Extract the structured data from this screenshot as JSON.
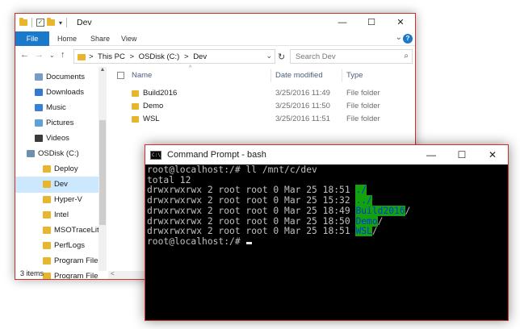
{
  "explorer": {
    "title": "Dev",
    "window_buttons": {
      "minimize": "—",
      "maximize": "☐",
      "close": "✕"
    },
    "ribbon": {
      "file": "File",
      "tabs": [
        "Home",
        "Share",
        "View"
      ]
    },
    "address": {
      "segments": [
        "This PC",
        ">",
        "OSDisk (C:)",
        ">",
        "Dev"
      ],
      "lead_chevron": ">"
    },
    "search_placeholder": "Search Dev",
    "nav_items": [
      {
        "label": "Documents",
        "icon": "documents-icon",
        "color": "#7a9bc5",
        "indent": 1
      },
      {
        "label": "Downloads",
        "icon": "downloads-icon",
        "color": "#2f7bd1",
        "indent": 1
      },
      {
        "label": "Music",
        "icon": "music-icon",
        "color": "#3b7fd0",
        "indent": 1
      },
      {
        "label": "Pictures",
        "icon": "pictures-icon",
        "color": "#5fa0d8",
        "indent": 1
      },
      {
        "label": "Videos",
        "icon": "videos-icon",
        "color": "#3a3a3a",
        "indent": 1
      },
      {
        "label": "OSDisk (C:)",
        "icon": "drive-icon",
        "color": "#6f8fae",
        "indent": 0
      },
      {
        "label": "Deploy",
        "icon": "folder-icon",
        "color": "#e8b52f",
        "indent": 2
      },
      {
        "label": "Dev",
        "icon": "folder-icon",
        "color": "#e8b52f",
        "indent": 2,
        "selected": true
      },
      {
        "label": "Hyper-V",
        "icon": "folder-icon",
        "color": "#e8b52f",
        "indent": 2
      },
      {
        "label": "Intel",
        "icon": "folder-icon",
        "color": "#e8b52f",
        "indent": 2
      },
      {
        "label": "MSOTraceLite",
        "icon": "folder-icon",
        "color": "#e8b52f",
        "indent": 2
      },
      {
        "label": "PerfLogs",
        "icon": "folder-icon",
        "color": "#e8b52f",
        "indent": 2
      },
      {
        "label": "Program Files",
        "icon": "folder-icon",
        "color": "#e8b52f",
        "indent": 2
      },
      {
        "label": "Program Files (x",
        "icon": "folder-icon",
        "color": "#e8b52f",
        "indent": 2
      }
    ],
    "columns": {
      "name": "Name",
      "date": "Date modified",
      "type": "Type"
    },
    "files": [
      {
        "name": "Build2016",
        "date": "3/25/2016 11:49",
        "type": "File folder"
      },
      {
        "name": "Demo",
        "date": "3/25/2016 11:50",
        "type": "File folder"
      },
      {
        "name": "WSL",
        "date": "3/25/2016 11:51",
        "type": "File folder"
      }
    ],
    "status": "3 items"
  },
  "cmd": {
    "title": "Command Prompt - bash",
    "window_buttons": {
      "minimize": "—",
      "maximize": "☐",
      "close": "✕"
    },
    "lines": [
      {
        "pre": "root@localhost:/# ll /mnt/c/dev"
      },
      {
        "pre": "total 12"
      },
      {
        "pre": "drwxrwxrwx 2 root root 0 Mar 25 18:51 ",
        "hl": "./",
        "post": ""
      },
      {
        "pre": "drwxrwxrwx 2 root root 0 Mar 25 15:32 ",
        "hl": "../",
        "post": ""
      },
      {
        "pre": "drwxrwxrwx 2 root root 0 Mar 25 18:49 ",
        "hl": "Build2016",
        "post": "/"
      },
      {
        "pre": "drwxrwxrwx 2 root root 0 Mar 25 18:50 ",
        "hl": "Demo",
        "post": "/"
      },
      {
        "pre": "drwxrwxrwx 2 root root 0 Mar 25 18:51 ",
        "hl": "WSL",
        "post": "/"
      },
      {
        "pre": "root@localhost:/# ",
        "cursor": true
      }
    ],
    "colors": {
      "background": "#000000",
      "text": "#c0c0c0",
      "dir_bg": "#13a10e",
      "dir_fg": "#0037da"
    }
  }
}
